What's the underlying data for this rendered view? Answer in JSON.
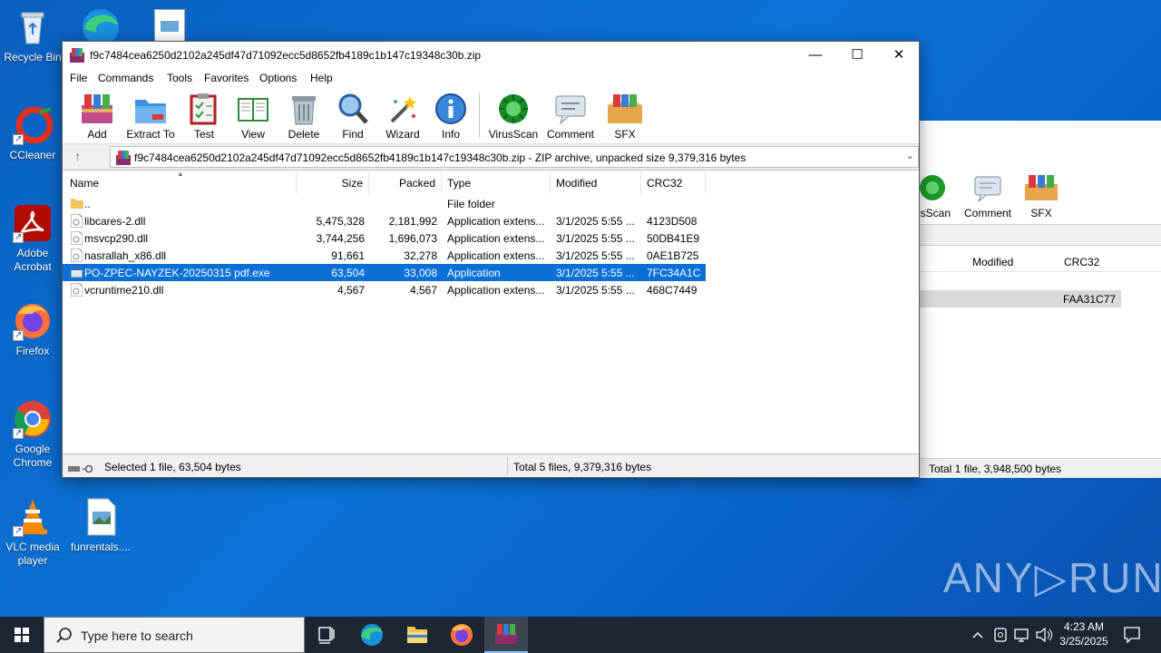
{
  "desktop": {
    "icons": [
      {
        "label": "Recycle Bin"
      },
      {
        "label": "CCleaner"
      },
      {
        "label": "Adobe Acrobat"
      },
      {
        "label": "Firefox"
      },
      {
        "label": "Google Chrome"
      },
      {
        "label": "VLC media player"
      },
      {
        "label": "funrentals...."
      }
    ],
    "watermark": "ANY▷RUN"
  },
  "back_window": {
    "toolbar": [
      "usScan",
      "Comment",
      "SFX"
    ],
    "columns": [
      "Modified",
      "CRC32"
    ],
    "row_crc": "FAA31C77",
    "status": "Total 1 file, 3,948,500 bytes"
  },
  "window": {
    "title": "f9c7484cea6250d2102a245df47d71092ecc5d8652fb4189c1b147c19348c30b.zip",
    "controls": {
      "minimize": "—",
      "maximize": "☐",
      "close": "✕"
    },
    "menu": [
      "File",
      "Commands",
      "Tools",
      "Favorites",
      "Options",
      "Help"
    ],
    "toolbar": [
      {
        "label": "Add",
        "icon": "add-archive-icon"
      },
      {
        "label": "Extract To",
        "icon": "extract-folder-icon"
      },
      {
        "label": "Test",
        "icon": "test-clipboard-icon"
      },
      {
        "label": "View",
        "icon": "view-book-icon"
      },
      {
        "label": "Delete",
        "icon": "trash-icon"
      },
      {
        "label": "Find",
        "icon": "magnifier-icon"
      },
      {
        "label": "Wizard",
        "icon": "wand-icon"
      },
      {
        "label": "Info",
        "icon": "info-icon"
      },
      {
        "label": "VirusScan",
        "icon": "virus-icon"
      },
      {
        "label": "Comment",
        "icon": "comment-icon"
      },
      {
        "label": "SFX",
        "icon": "sfx-box-icon"
      }
    ],
    "address": "f9c7484cea6250d2102a245df47d71092ecc5d8652fb4189c1b147c19348c30b.zip - ZIP archive, unpacked size 9,379,316 bytes",
    "columns": [
      "Name",
      "Size",
      "Packed",
      "Type",
      "Modified",
      "CRC32"
    ],
    "files": [
      {
        "name": "..",
        "size": "",
        "packed": "",
        "type": "File folder",
        "modified": "",
        "crc": "",
        "kind": "folder"
      },
      {
        "name": "libcares-2.dll",
        "size": "5,475,328",
        "packed": "2,181,992",
        "type": "Application extens...",
        "modified": "3/1/2025 5:55 ...",
        "crc": "4123D508",
        "kind": "dll"
      },
      {
        "name": "msvcp290.dll",
        "size": "3,744,256",
        "packed": "1,696,073",
        "type": "Application extens...",
        "modified": "3/1/2025 5:55 ...",
        "crc": "50DB41E9",
        "kind": "dll"
      },
      {
        "name": "nasrallah_x86.dll",
        "size": "91,661",
        "packed": "32,278",
        "type": "Application extens...",
        "modified": "3/1/2025 5:55 ...",
        "crc": "0AE1B725",
        "kind": "dll"
      },
      {
        "name": "PO-ZPEC-NAYZEK-20250315 pdf.exe",
        "size": "63,504",
        "packed": "33,008",
        "type": "Application",
        "modified": "3/1/2025 5:55 ...",
        "crc": "7FC34A1C",
        "kind": "exe",
        "selected": true
      },
      {
        "name": "vcruntime210.dll",
        "size": "4,567",
        "packed": "4,567",
        "type": "Application extens...",
        "modified": "3/1/2025 5:55 ...",
        "crc": "468C7449",
        "kind": "dll"
      }
    ],
    "status_left": "Selected 1 file, 63,504 bytes",
    "status_right": "Total 5 files, 9,379,316 bytes"
  },
  "taskbar": {
    "search_placeholder": "Type here to search",
    "time": "4:23 AM",
    "date": "3/25/2025"
  },
  "colors": {
    "selection": "#0a6fd6",
    "taskbar": "#1c2733",
    "desktop": "#0b74d6"
  }
}
